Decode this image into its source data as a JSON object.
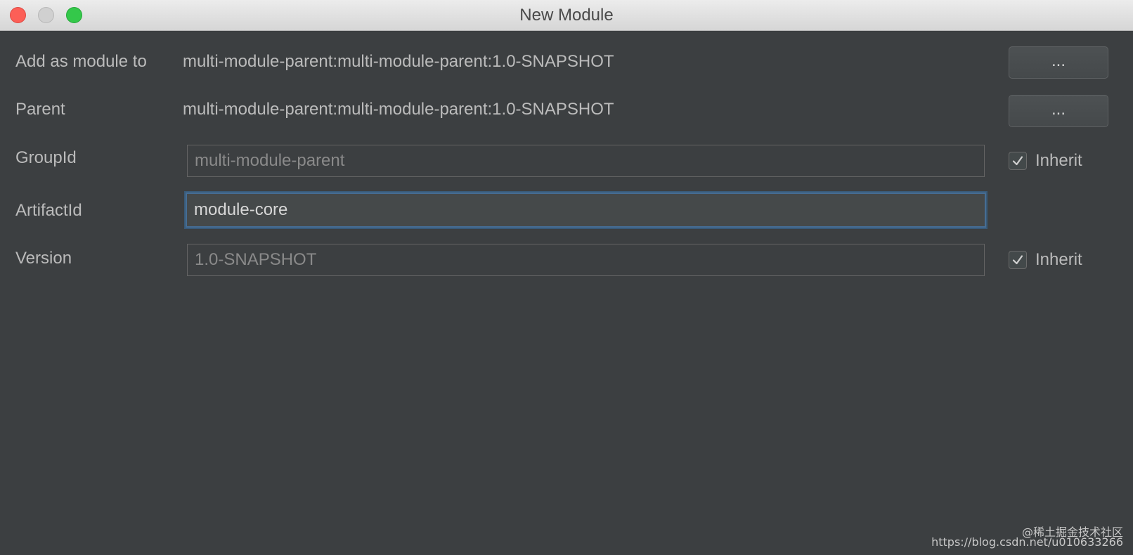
{
  "window": {
    "title": "New Module"
  },
  "form": {
    "add_as_module_to": {
      "label": "Add as module to",
      "value": "multi-module-parent:multi-module-parent:1.0-SNAPSHOT",
      "button_label": "..."
    },
    "parent": {
      "label": "Parent",
      "value": "multi-module-parent:multi-module-parent:1.0-SNAPSHOT",
      "button_label": "..."
    },
    "group_id": {
      "label": "GroupId",
      "value": "multi-module-parent",
      "inherit_label": "Inherit",
      "inherit_checked": true
    },
    "artifact_id": {
      "label": "ArtifactId",
      "value": "module-core"
    },
    "version": {
      "label": "Version",
      "value": "1.0-SNAPSHOT",
      "inherit_label": "Inherit",
      "inherit_checked": true
    }
  },
  "watermark": {
    "line1": "@稀土掘金技术社区",
    "line2": "https://blog.csdn.net/u010633266"
  },
  "colors": {
    "background": "#3c3f41",
    "focus_border": "#466d94",
    "close": "#fc5f57",
    "maximize": "#34c84a"
  },
  "icons": {
    "checkbox": "check-icon"
  }
}
